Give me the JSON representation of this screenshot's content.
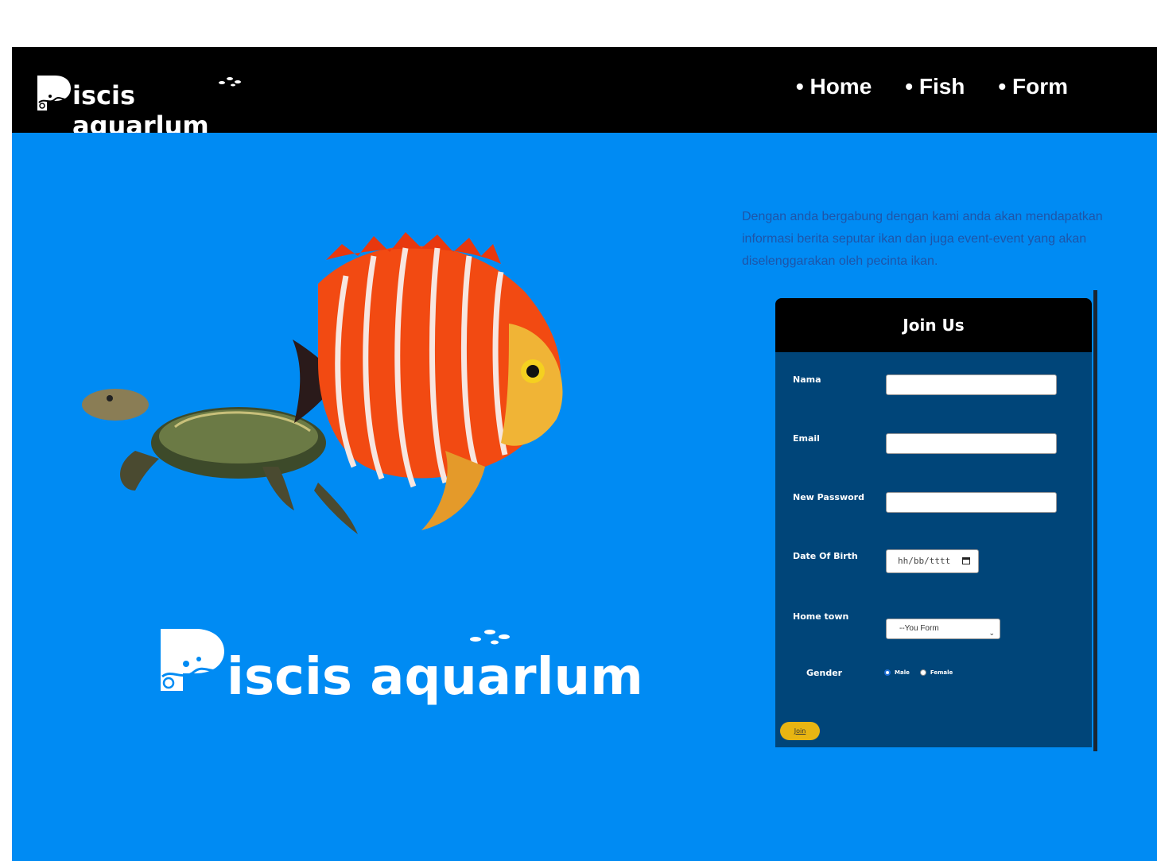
{
  "brand": {
    "name": "Piscis aquarlum",
    "name_rest": "iscis aquarlum"
  },
  "nav": {
    "items": [
      "• Home",
      "• Fish",
      "• Form"
    ]
  },
  "intro_text": "Dengan anda bergabung dengan kami anda akan mendapatkan informasi berita seputar ikan dan juga event-event yang akan diselenggarakan oleh pecinta ikan.",
  "form": {
    "title": "Join Us",
    "labels": {
      "nama": "Nama",
      "email": "Email",
      "password": "New Password",
      "dob": "Date Of Birth",
      "hometown": "Home town",
      "gender": "Gender"
    },
    "dob_placeholder": "hh/bb/tttt",
    "hometown_selected": "--You Form",
    "gender_options": [
      "Male",
      "Female"
    ],
    "gender_selected": "Male",
    "submit_label": "Join"
  },
  "colors": {
    "navbar": "#000000",
    "hero_bg": "#008bf3",
    "form_bg": "#004579",
    "button": "#e8b512",
    "intro_text": "#1e55a8"
  }
}
